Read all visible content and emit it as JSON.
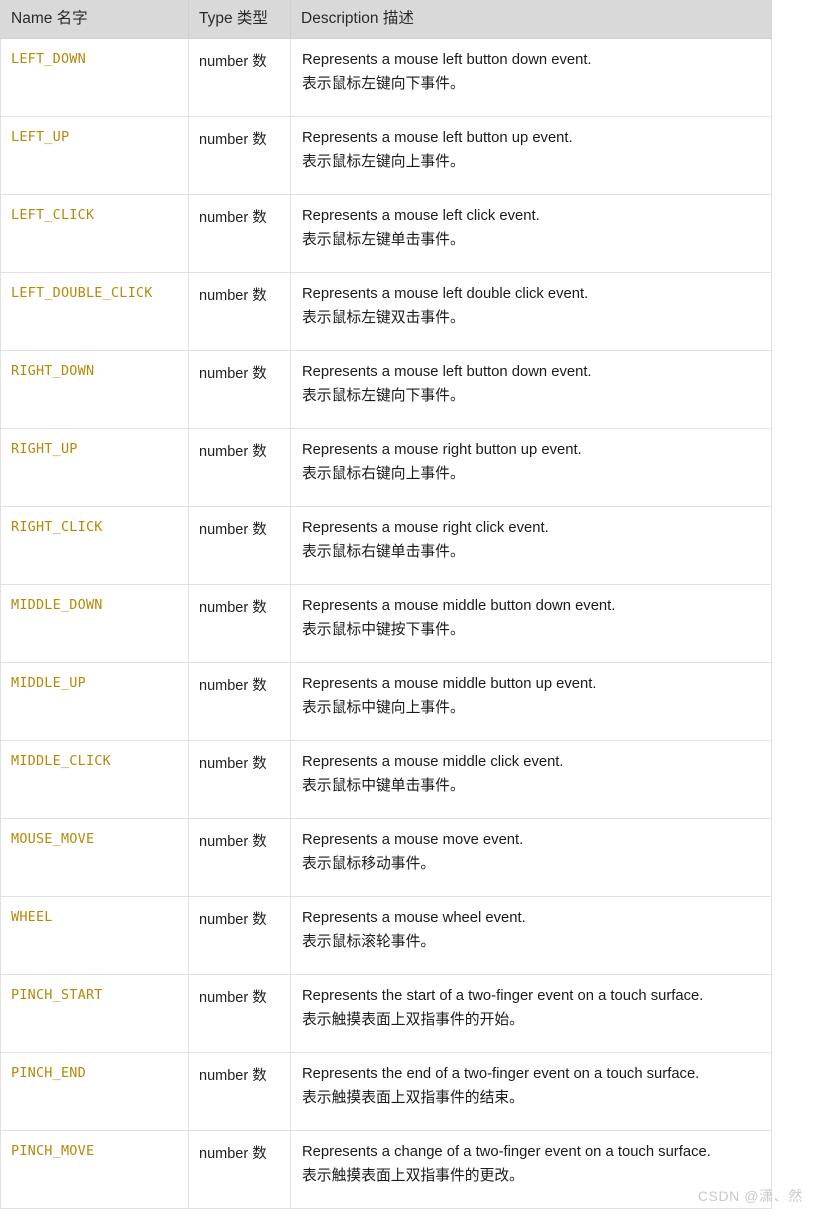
{
  "table": {
    "columns": [
      {
        "key": "name",
        "label": "Name 名字"
      },
      {
        "key": "type",
        "label": "Type 类型"
      },
      {
        "key": "description",
        "label": "Description 描述"
      }
    ],
    "rows": [
      {
        "name": "LEFT_DOWN",
        "type": "number 数",
        "desc_en": "Represents a mouse left button down event.",
        "desc_zh": "表示鼠标左键向下事件。"
      },
      {
        "name": "LEFT_UP",
        "type": "number 数",
        "desc_en": "Represents a mouse left button up event.",
        "desc_zh": "表示鼠标左键向上事件。"
      },
      {
        "name": "LEFT_CLICK",
        "type": "number 数",
        "desc_en": "Represents a mouse left click event.",
        "desc_zh": "表示鼠标左键单击事件。"
      },
      {
        "name": "LEFT_DOUBLE_CLICK",
        "type": "number 数",
        "desc_en": "Represents a mouse left double click event.",
        "desc_zh": "表示鼠标左键双击事件。"
      },
      {
        "name": "RIGHT_DOWN",
        "type": "number 数",
        "desc_en": "Represents a mouse left button down event.",
        "desc_zh": "表示鼠标左键向下事件。"
      },
      {
        "name": "RIGHT_UP",
        "type": "number 数",
        "desc_en": "Represents a mouse right button up event.",
        "desc_zh": "表示鼠标右键向上事件。"
      },
      {
        "name": "RIGHT_CLICK",
        "type": "number 数",
        "desc_en": "Represents a mouse right click event.",
        "desc_zh": "表示鼠标右键单击事件。"
      },
      {
        "name": "MIDDLE_DOWN",
        "type": "number 数",
        "desc_en": "Represents a mouse middle button down event.",
        "desc_zh": "表示鼠标中键按下事件。"
      },
      {
        "name": "MIDDLE_UP",
        "type": "number 数",
        "desc_en": "Represents a mouse middle button up event.",
        "desc_zh": "表示鼠标中键向上事件。"
      },
      {
        "name": "MIDDLE_CLICK",
        "type": "number 数",
        "desc_en": "Represents a mouse middle click event.",
        "desc_zh": "表示鼠标中键单击事件。"
      },
      {
        "name": "MOUSE_MOVE",
        "type": "number 数",
        "desc_en": "Represents a mouse move event.",
        "desc_zh": "表示鼠标移动事件。"
      },
      {
        "name": "WHEEL",
        "type": "number 数",
        "desc_en": "Represents a mouse wheel event.",
        "desc_zh": "表示鼠标滚轮事件。"
      },
      {
        "name": "PINCH_START",
        "type": "number 数",
        "desc_en": "Represents the start of a two-finger event on a touch surface.",
        "desc_zh": "表示触摸表面上双指事件的开始。"
      },
      {
        "name": "PINCH_END",
        "type": "number 数",
        "desc_en": "Represents the end of a two-finger event on a touch surface.",
        "desc_zh": "表示触摸表面上双指事件的结束。"
      },
      {
        "name": "PINCH_MOVE",
        "type": "number 数",
        "desc_en": "Represents a change of a two-finger event on a touch surface.",
        "desc_zh": "表示触摸表面上双指事件的更改。"
      }
    ]
  },
  "watermark": {
    "text": "CSDN @潇、然"
  },
  "colors": {
    "header_background": "#d9d9d9",
    "name_text": "#b5890c",
    "body_text": "#1b1b1b",
    "row_border": "#e2e2e2",
    "watermark_text": "#c9c9c9"
  }
}
